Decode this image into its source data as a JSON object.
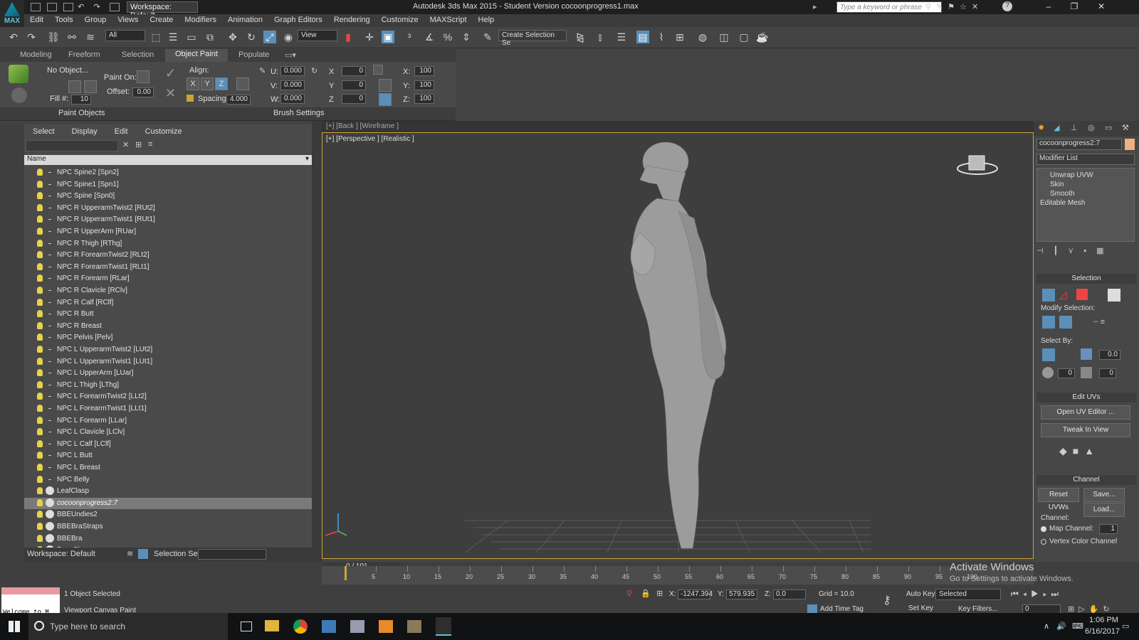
{
  "app": {
    "title": "Autodesk 3ds Max  2015  - Student Version    cocoonprogress1.max",
    "logo_text": "MAX",
    "workspace": "Workspace: Default",
    "search_placeholder": "Type a keyword or phrase",
    "accent": "#5b8fb7"
  },
  "menu": [
    "Edit",
    "Tools",
    "Group",
    "Views",
    "Create",
    "Modifiers",
    "Animation",
    "Graph Editors",
    "Rendering",
    "Customize",
    "MAXScript",
    "Help"
  ],
  "toolbar": {
    "selection_filter": "All",
    "ref_coord": "View",
    "selection_set_placeholder": "Create Selection Se"
  },
  "ribbon": {
    "tabs": [
      "Modeling",
      "Freeform",
      "Selection",
      "Object Paint",
      "Populate"
    ],
    "active_tab": "Object Paint",
    "no_object": "No Object...",
    "paint_on": "Paint On:",
    "offset_label": "Offset:",
    "offset_value": "0.00",
    "fill_label": "Fill #:",
    "fill_value": "10",
    "align_label": "Align:",
    "axes": [
      "X",
      "Y",
      "Z"
    ],
    "spacing_label": "Spacing:",
    "spacing_value": "4.000",
    "u_label": "U:",
    "u_value": "0.000",
    "v_label": "V:",
    "v_value": "0.000",
    "w_label": "W:",
    "w_value": "0.000",
    "rx_label": "X",
    "rx_value": "0",
    "ry_label": "Y",
    "ry_value": "0",
    "rz_label": "Z",
    "rz_value": "0",
    "sx_label": "X:",
    "sx_value": "100",
    "sy_label": "Y:",
    "sy_value": "100",
    "sz_label": "Z:",
    "sz_value": "100",
    "paint_objects": "Paint Objects",
    "brush_settings": "Brush Settings"
  },
  "explorer": {
    "menu": [
      "Select",
      "Display",
      "Edit",
      "Customize"
    ],
    "column": "Name",
    "items": [
      "NPC Spine2 [Spn2]",
      "NPC Spine1 [Spn1]",
      "NPC Spine [Spn0]",
      "NPC R UpperarmTwist2 [RUt2]",
      "NPC R UpperarmTwist1 [RUt1]",
      "NPC R UpperArm [RUar]",
      "NPC R Thigh [RThg]",
      "NPC R ForearmTwist2 [RLt2]",
      "NPC R ForearmTwist1 [RLt1]",
      "NPC R Forearm [RLar]",
      "NPC R Clavicle [RClv]",
      "NPC R Calf [RClf]",
      "NPC R Butt",
      "NPC R Breast",
      "NPC Pelvis [Pelv]",
      "NPC L UpperarmTwist2 [LUt2]",
      "NPC L UpperarmTwist1 [LUt1]",
      "NPC L UpperArm [LUar]",
      "NPC L Thigh [LThg]",
      "NPC L ForearmTwist2 [LLt2]",
      "NPC L ForearmTwist1 [LLt1]",
      "NPC L Forearm [LLar]",
      "NPC L Clavicle [LClv]",
      "NPC L Calf [LClf]",
      "NPC L Butt",
      "NPC L Breast",
      "NPC Belly",
      "LeafClasp",
      "cocoonprogress2:7",
      "BBEUndies2",
      "BBEBraStraps",
      "BBEBra",
      "BaseShape"
    ],
    "selected": "cocoonprogress2:7",
    "workspace": "Workspace: Default",
    "selection_set_label": "Selection Set:"
  },
  "viewport": {
    "top_label": "[+] [Back ] [Wireframe ]",
    "label": "[+] [Perspective ] [Realistic ]",
    "frame": "0 / 101"
  },
  "command_panel": {
    "object_name": "cocoonprogress2:7",
    "modifier_list": "Modifier List",
    "stack": [
      "Unwrap UVW",
      "Skin",
      "Smooth",
      "Editable Mesh"
    ],
    "selection_title": "Selection",
    "modify_selection": "Modify Selection:",
    "select_by": "Select By:",
    "select_by_value": "0.0",
    "select_by_val2": "0",
    "select_by_val3": "0",
    "edit_uvs_title": "Edit UVs",
    "open_uv_editor": "Open UV Editor ...",
    "tweak_in_view": "Tweak In View",
    "channel_title": "Channel",
    "reset_uvws": "Reset UVWs",
    "save": "Save...",
    "load": "Load...",
    "channel_label": "Channel:",
    "map_channel": "Map Channel:",
    "map_channel_value": "1",
    "vertex_color_channel": "Vertex Color Channel"
  },
  "timeline": {
    "ticks": [
      "5",
      "10",
      "15",
      "20",
      "25",
      "30",
      "35",
      "40",
      "45",
      "50",
      "55",
      "60",
      "65",
      "70",
      "75",
      "80",
      "85",
      "90",
      "95",
      "100"
    ]
  },
  "status": {
    "welcome": "Welcome to M",
    "objects_selected": "1 Object Selected",
    "prompt": "Viewport Canvas Paint",
    "x_label": "X:",
    "x_value": "-1247.394",
    "y_label": "Y:",
    "y_value": "579.935",
    "z_label": "Z:",
    "z_value": "0.0",
    "grid": "Grid = 10.0",
    "add_time_tag": "Add Time Tag",
    "auto_key": "Auto Key",
    "set_key": "Set Key",
    "selected_dd": "Selected",
    "key_filters": "Key Filters...",
    "frame_value": "0"
  },
  "watermark": {
    "line1": "Activate Windows",
    "line2": "Go to Settings to activate Windows."
  },
  "taskbar": {
    "search_placeholder": "Type here to search",
    "time": "1:06 PM",
    "date": "6/16/2017"
  }
}
